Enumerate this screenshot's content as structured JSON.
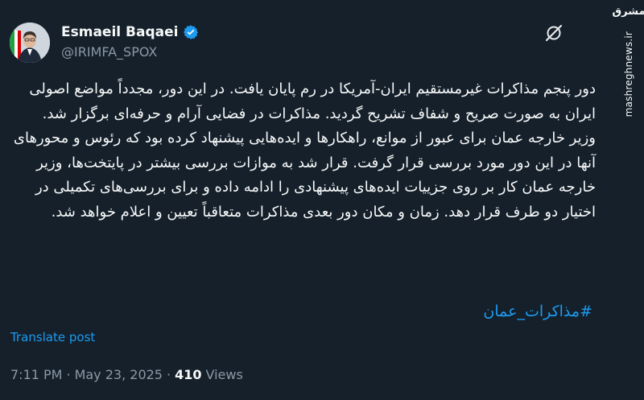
{
  "author": {
    "name": "Esmaeil Baqaei",
    "handle": "@IRIMFA_SPOX",
    "verified": true
  },
  "tweet": {
    "paragraphs": [
      "دور پنجم مذاکرات غیرمستقیم ایران-آمریکا در رم پایان یافت. در این دور، مجدداً مواضع اصولی ایران به صورت صریح و شفاف تشریح گردید. مذاکرات در فضایی آرام و حرفه‌ای برگزار شد.",
      "وزیر خارجه عمان برای عبور از موانع، راهکارها و ایده‌هایی پیشنهاد کرده بود که رئوس و محورهای آنها در این دور مورد بررسی قرار گرفت. قرار شد به موازات بررسی بیشتر در پایتخت‌ها، وزیر خارجه عمان کار بر روی جزییات ایده‌های پیشنهادی را ادامه داده و برای بررسی‌های تکمیلی در اختیار دو طرف قرار دهد. زمان و مکان دور بعدی مذاکرات متعاقباً تعیین و اعلام خواهد شد."
    ],
    "hashtag": "#مذاکرات_عمان",
    "translate_label": "Translate post",
    "time": "7:11 PM",
    "separator": "·",
    "date": "May 23, 2025",
    "separator2": "·",
    "views_count": "410",
    "views_label": "Views"
  },
  "watermark": {
    "logo_text": "مشرق",
    "url": "mashreghnews.ir"
  },
  "colors": {
    "background": "#15202b",
    "text": "#f7f9f9",
    "secondary": "#8b98a5",
    "link": "#1d9bf0"
  },
  "icons": {
    "verified": "verified-badge-icon",
    "grok": "grok-icon"
  }
}
